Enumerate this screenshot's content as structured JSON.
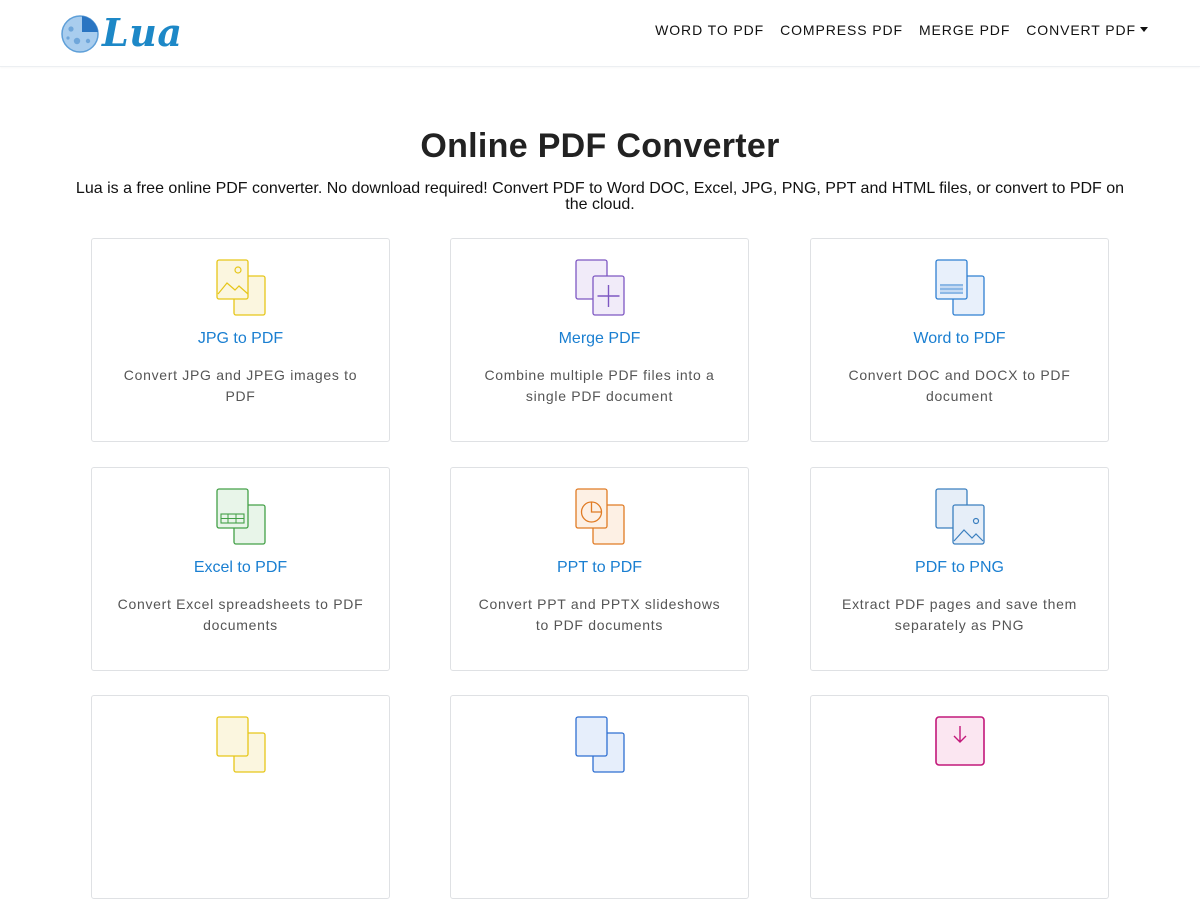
{
  "brand": {
    "name": "Lua",
    "logo_icon": "moon-icon",
    "color": "#1d88c7"
  },
  "nav": {
    "items": [
      {
        "label": "WORD TO PDF"
      },
      {
        "label": "COMPRESS PDF"
      },
      {
        "label": "MERGE PDF"
      },
      {
        "label": "CONVERT PDF",
        "has_dropdown": true
      }
    ]
  },
  "hero": {
    "title": "Online PDF Converter",
    "subtitle": "Lua is a free online PDF converter. No download required! Convert PDF to Word DOC, Excel, JPG, PNG, PPT and HTML files, or convert to PDF on the cloud."
  },
  "tools": [
    {
      "title": "JPG to PDF",
      "desc": "Convert JPG and JPEG images to PDF",
      "icon": "image-file-icon",
      "color": "#e6c619"
    },
    {
      "title": "Merge PDF",
      "desc": "Combine multiple PDF files into a single PDF document",
      "icon": "merge-files-icon",
      "color": "#7e57c2"
    },
    {
      "title": "Word to PDF",
      "desc": "Convert DOC and DOCX to PDF document",
      "icon": "word-file-icon",
      "color": "#2f7fd1"
    },
    {
      "title": "Excel to PDF",
      "desc": "Convert Excel spreadsheets to PDF documents",
      "icon": "excel-file-icon",
      "color": "#43a047"
    },
    {
      "title": "PPT to PDF",
      "desc": "Convert PPT and PPTX slideshows to PDF documents",
      "icon": "ppt-file-icon",
      "color": "#e07b24"
    },
    {
      "title": "PDF to PNG",
      "desc": "Extract PDF pages and save them separately as PNG",
      "icon": "png-file-icon",
      "color": "#3b7fbf"
    },
    {
      "title": "",
      "desc": "",
      "icon": "image-file-icon",
      "color": "#e6c619"
    },
    {
      "title": "",
      "desc": "",
      "icon": "file-icon",
      "color": "#2f6fd1"
    },
    {
      "title": "",
      "desc": "",
      "icon": "download-file-icon",
      "color": "#c2187a"
    }
  ],
  "colors": {
    "link": "#1a7fd1",
    "card_border": "#dfe1e4",
    "text_muted": "#555555"
  }
}
